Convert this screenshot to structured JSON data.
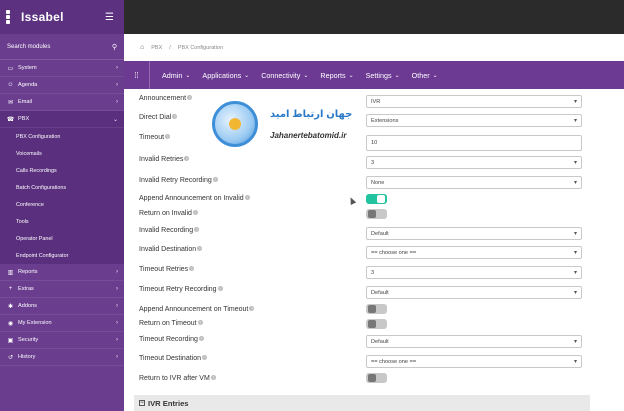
{
  "app": {
    "brand": "Issabel"
  },
  "sidebar": {
    "search_label": "Search modules",
    "items": [
      {
        "label": "System",
        "icon": "monitor-icon",
        "chevron": "›"
      },
      {
        "label": "Agenda",
        "icon": "person-icon",
        "chevron": "›"
      },
      {
        "label": "Email",
        "icon": "envelope-icon",
        "chevron": "›"
      },
      {
        "label": "PBX",
        "icon": "phone-icon",
        "chevron": "⌄"
      },
      {
        "label": "Reports",
        "icon": "bar-chart-icon",
        "chevron": "›"
      },
      {
        "label": "Extras",
        "icon": "plus-icon",
        "chevron": "›"
      },
      {
        "label": "Addons",
        "icon": "puzzle-icon",
        "chevron": "›"
      },
      {
        "label": "My Extension",
        "icon": "user-icon",
        "chevron": "›"
      },
      {
        "label": "Security",
        "icon": "lock-icon",
        "chevron": "›"
      },
      {
        "label": "History",
        "icon": "history-icon",
        "chevron": "›"
      }
    ],
    "pbx_subitems": [
      "PBX Configuration",
      "Voicemails",
      "Calls Recordings",
      "Batch Configurations",
      "Conference",
      "Tools",
      "Operator Panel",
      "Endpoint Configurator"
    ]
  },
  "breadcrumb": {
    "section": "PBX",
    "page": "PBX Configuration"
  },
  "menubar": [
    "Admin",
    "Applications",
    "Connectivity",
    "Reports",
    "Settings",
    "Other"
  ],
  "form": {
    "announcement": {
      "label": "Announcement",
      "value": "IVR"
    },
    "direct_dial": {
      "label": "Direct Dial",
      "value": "Extensions"
    },
    "timeout": {
      "label": "Timeout",
      "value": "10"
    },
    "invalid_retries": {
      "label": "Invalid Retries",
      "value": "3"
    },
    "invalid_retry_recording": {
      "label": "Invalid Retry Recording",
      "value": "None"
    },
    "append_announcement_invalid": {
      "label": "Append Announcement on Invalid",
      "on": true
    },
    "return_on_invalid": {
      "label": "Return on Invalid",
      "on": false
    },
    "invalid_recording": {
      "label": "Invalid Recording",
      "value": "Default"
    },
    "invalid_destination": {
      "label": "Invalid Destination",
      "value": "== choose one =="
    },
    "timeout_retries": {
      "label": "Timeout Retries",
      "value": "3"
    },
    "timeout_retry_recording": {
      "label": "Timeout Retry Recording",
      "value": "Default"
    },
    "append_announcement_timeout": {
      "label": "Append Announcement on Timeout",
      "on": false
    },
    "return_on_timeout": {
      "label": "Return on Timeout",
      "on": false
    },
    "timeout_recording": {
      "label": "Timeout Recording",
      "value": "Default"
    },
    "timeout_destination": {
      "label": "Timeout Destination",
      "value": "== choose one =="
    },
    "return_to_ivr_after_vm": {
      "label": "Return to IVR after VM",
      "on": false
    },
    "help_glyph": "?",
    "caret": "▾"
  },
  "ivr_entries": {
    "label": "IVR Entries",
    "toggle_glyph": "−"
  },
  "watermark": {
    "title_fa": "جهان ارتباط امید",
    "url": "Jahanertebatomid.ir"
  },
  "colors": {
    "sidebar": "#6a3d8f",
    "menubar": "#6c3a93",
    "toggle_on": "#22c4a0"
  }
}
